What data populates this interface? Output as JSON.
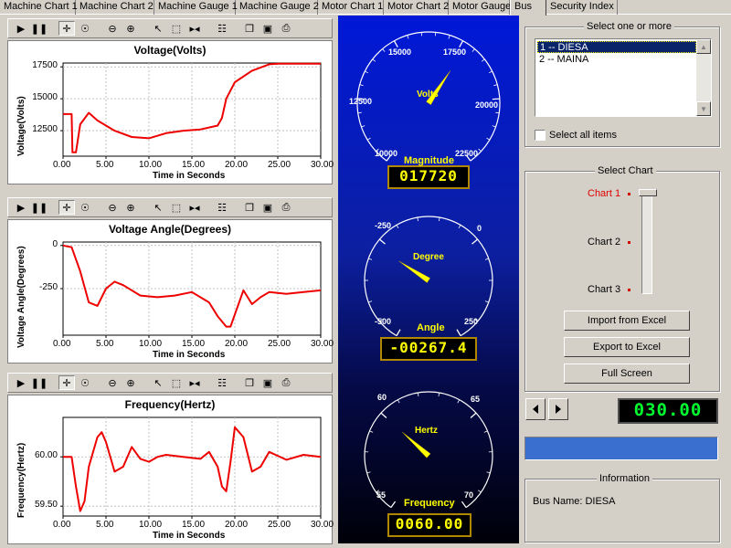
{
  "tabs": [
    {
      "label": "Machine Chart 1"
    },
    {
      "label": "Machine Chart 2"
    },
    {
      "label": "Machine Gauge 1"
    },
    {
      "label": "Machine Gauge 2"
    },
    {
      "label": "Motor Chart 1"
    },
    {
      "label": "Motor Chart 2"
    },
    {
      "label": "Motor Gauge"
    },
    {
      "label": "Bus",
      "active": true
    },
    {
      "label": "Security Index"
    }
  ],
  "toolbar_icons": [
    "play-icon",
    "pause-icon",
    "pan-icon",
    "zoom-pan-icon",
    "zoom-out-icon",
    "zoom-in-icon",
    "pointer-icon",
    "select-box-icon",
    "marker-icon",
    "properties-icon",
    "copy-icon",
    "save-icon",
    "print-icon"
  ],
  "chart_data": [
    {
      "type": "line",
      "title": "Voltage(Volts)",
      "xlabel": "Time in Seconds",
      "ylabel": "Voltage(Volts)",
      "xlim": [
        0,
        30
      ],
      "ylim": [
        10500,
        17800
      ],
      "xticks": [
        "0.00",
        "5.00",
        "10.00",
        "15.00",
        "20.00",
        "25.00",
        "30.00"
      ],
      "yticks": [
        {
          "v": 12500,
          "t": "12500"
        },
        {
          "v": 15000,
          "t": "15000"
        },
        {
          "v": 17500,
          "t": "17500"
        }
      ],
      "grid": true,
      "color": "#ee0000",
      "x": [
        0,
        1,
        1.1,
        1.5,
        2,
        3,
        4,
        6,
        8,
        10,
        12,
        14,
        16,
        18,
        18.5,
        19,
        20,
        22,
        24,
        25,
        30
      ],
      "y": [
        13800,
        13800,
        10800,
        10800,
        13000,
        13900,
        13300,
        12500,
        12000,
        11900,
        12300,
        12500,
        12600,
        12900,
        13500,
        15000,
        16300,
        17200,
        17700,
        17750,
        17750
      ]
    },
    {
      "type": "line",
      "title": "Voltage Angle(Degrees)",
      "xlabel": "Time in Seconds",
      "ylabel": "Voltage Angle(Degrees)",
      "xlim": [
        0,
        30
      ],
      "ylim": [
        -520,
        20
      ],
      "xticks": [
        "0.00",
        "5.00",
        "10.00",
        "15.00",
        "20.00",
        "25.00",
        "30.00"
      ],
      "yticks": [
        {
          "v": 0,
          "t": "0"
        },
        {
          "v": -250,
          "t": "-250"
        }
      ],
      "grid": true,
      "color": "#ee0000",
      "x": [
        0,
        1,
        2,
        3,
        4,
        5,
        6,
        7,
        9,
        11,
        13,
        15,
        17,
        18,
        19,
        19.5,
        20,
        21,
        22,
        23,
        24,
        26,
        28,
        30
      ],
      "y": [
        0,
        -10,
        -150,
        -330,
        -350,
        -250,
        -210,
        -230,
        -290,
        -300,
        -290,
        -270,
        -330,
        -410,
        -470,
        -470,
        -400,
        -260,
        -340,
        -300,
        -270,
        -280,
        -270,
        -260
      ]
    },
    {
      "type": "line",
      "title": "Frequency(Hertz)",
      "xlabel": "Time in Seconds",
      "ylabel": "Frequency(Hertz)",
      "xlim": [
        0,
        30
      ],
      "ylim": [
        59.4,
        60.4
      ],
      "xticks": [
        "0.00",
        "5.00",
        "10.00",
        "15.00",
        "20.00",
        "25.00",
        "30.00"
      ],
      "yticks": [
        {
          "v": 60.0,
          "t": "60.00"
        },
        {
          "v": 59.5,
          "t": "59.50"
        }
      ],
      "grid": true,
      "color": "#ee0000",
      "x": [
        0,
        1,
        1.5,
        2,
        2.5,
        3,
        4,
        4.5,
        5,
        6,
        7,
        8,
        9,
        10,
        11,
        12,
        14,
        16,
        17,
        18,
        18.5,
        19,
        19.5,
        20,
        21,
        22,
        23,
        24,
        26,
        28,
        30
      ],
      "y": [
        60.0,
        60.0,
        59.7,
        59.45,
        59.55,
        59.9,
        60.2,
        60.25,
        60.15,
        59.85,
        59.9,
        60.1,
        59.98,
        59.95,
        60.0,
        60.02,
        60.0,
        59.98,
        60.05,
        59.9,
        59.7,
        59.65,
        59.95,
        60.3,
        60.2,
        59.85,
        59.9,
        60.05,
        59.97,
        60.02,
        60.0
      ]
    }
  ],
  "gauges": [
    {
      "unit": "Volts",
      "name": "Magnitude",
      "labels": [
        "10000",
        "12500",
        "15000",
        "17500",
        "20000",
        "22500"
      ],
      "min": 10000,
      "max": 22500,
      "value": 17720,
      "display": "017720"
    },
    {
      "unit": "Degree",
      "name": "Angle",
      "labels": [
        "-500",
        "-250",
        "0",
        "250"
      ],
      "min": -500,
      "max": 250,
      "value": -267.4,
      "display": "-00267.4"
    },
    {
      "unit": "Hertz",
      "name": "Frequency",
      "labels": [
        "55",
        "60",
        "65",
        "70"
      ],
      "min": 55,
      "max": 70,
      "value": 60.0,
      "display": "0060.00"
    }
  ],
  "selector": {
    "title": "Select one or more",
    "items": [
      "1 -- DIESA",
      "2 -- MAINA"
    ],
    "selected_index": 0,
    "select_all_label": "Select all items"
  },
  "select_chart": {
    "title": "Select Chart",
    "options": [
      "Chart 1",
      "Chart 2",
      "Chart 3"
    ],
    "active_index": 0,
    "active_color": "#e00000"
  },
  "buttons": {
    "import": "Import from Excel",
    "export": "Export to Excel",
    "fullscreen": "Full Screen"
  },
  "time_display": "030.00",
  "progress": 1.0,
  "info": {
    "title": "Information",
    "text": "Bus Name: DIESA"
  }
}
